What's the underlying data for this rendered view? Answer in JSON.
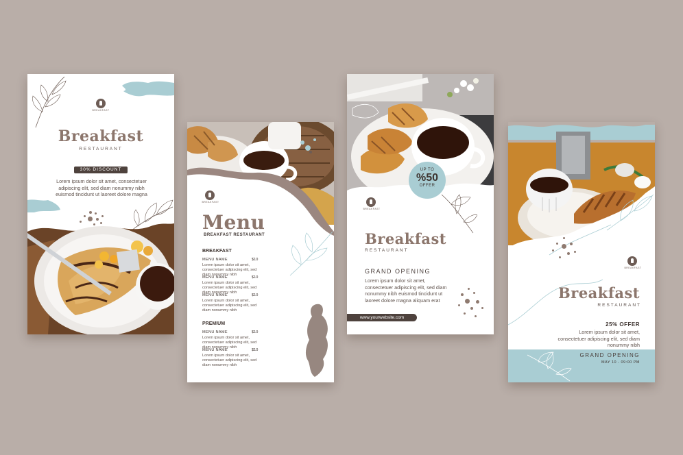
{
  "colors": {
    "background": "#b9aea8",
    "brown": "#8c766c",
    "dark_brown": "#6d5c55",
    "light_blue": "#a9cdd3"
  },
  "card1": {
    "logo_label": "BREAKFAST",
    "title": "Breakfast",
    "subtitle": "RESTAURANT",
    "badge": "30% DISCOUNT",
    "body": "Lorem ipsum dolor sit amet, consectetuer adipiscing elit, sed diam nonummy nibh euismod tincidunt ut laoreet dolore magna"
  },
  "card2": {
    "logo_label": "BREAKFAST",
    "title": "Menu",
    "subtitle": "BREAKFAST RESTAURANT",
    "section1": "BREAKFAST",
    "section2": "PREMIUM",
    "item_name": "MENU NAME",
    "item_price": "$10",
    "item_desc": "Lorem ipsum dolor sit amet, consectetuer adipiscing elit, sed diam nonummy nibh"
  },
  "card3": {
    "badge_top": "UP TO",
    "badge_value": "%50",
    "badge_bottom": "OFFER",
    "logo_label": "BREAKFAST",
    "title": "Breakfast",
    "subtitle": "RESTAURANT",
    "heading": "GRAND OPENING",
    "body": "Lorem ipsum dolor sit amet, consectetuer adipiscing elit, sed diam nonummy nibh euismod tincidunt ut laoreet dolore magna aliquam erat",
    "website": "www.yourwebsite.com"
  },
  "card4": {
    "logo_label": "BREAKFAST",
    "title": "Breakfast",
    "subtitle": "RESTAURANT",
    "offer": "25% OFFER",
    "body": "Lorem ipsum dolor sit amet, consectetuer adipiscing elit, sed diam nonummy nibh",
    "heading": "GRAND OPENING",
    "date": "MAY 10 - 09:00 PM"
  }
}
